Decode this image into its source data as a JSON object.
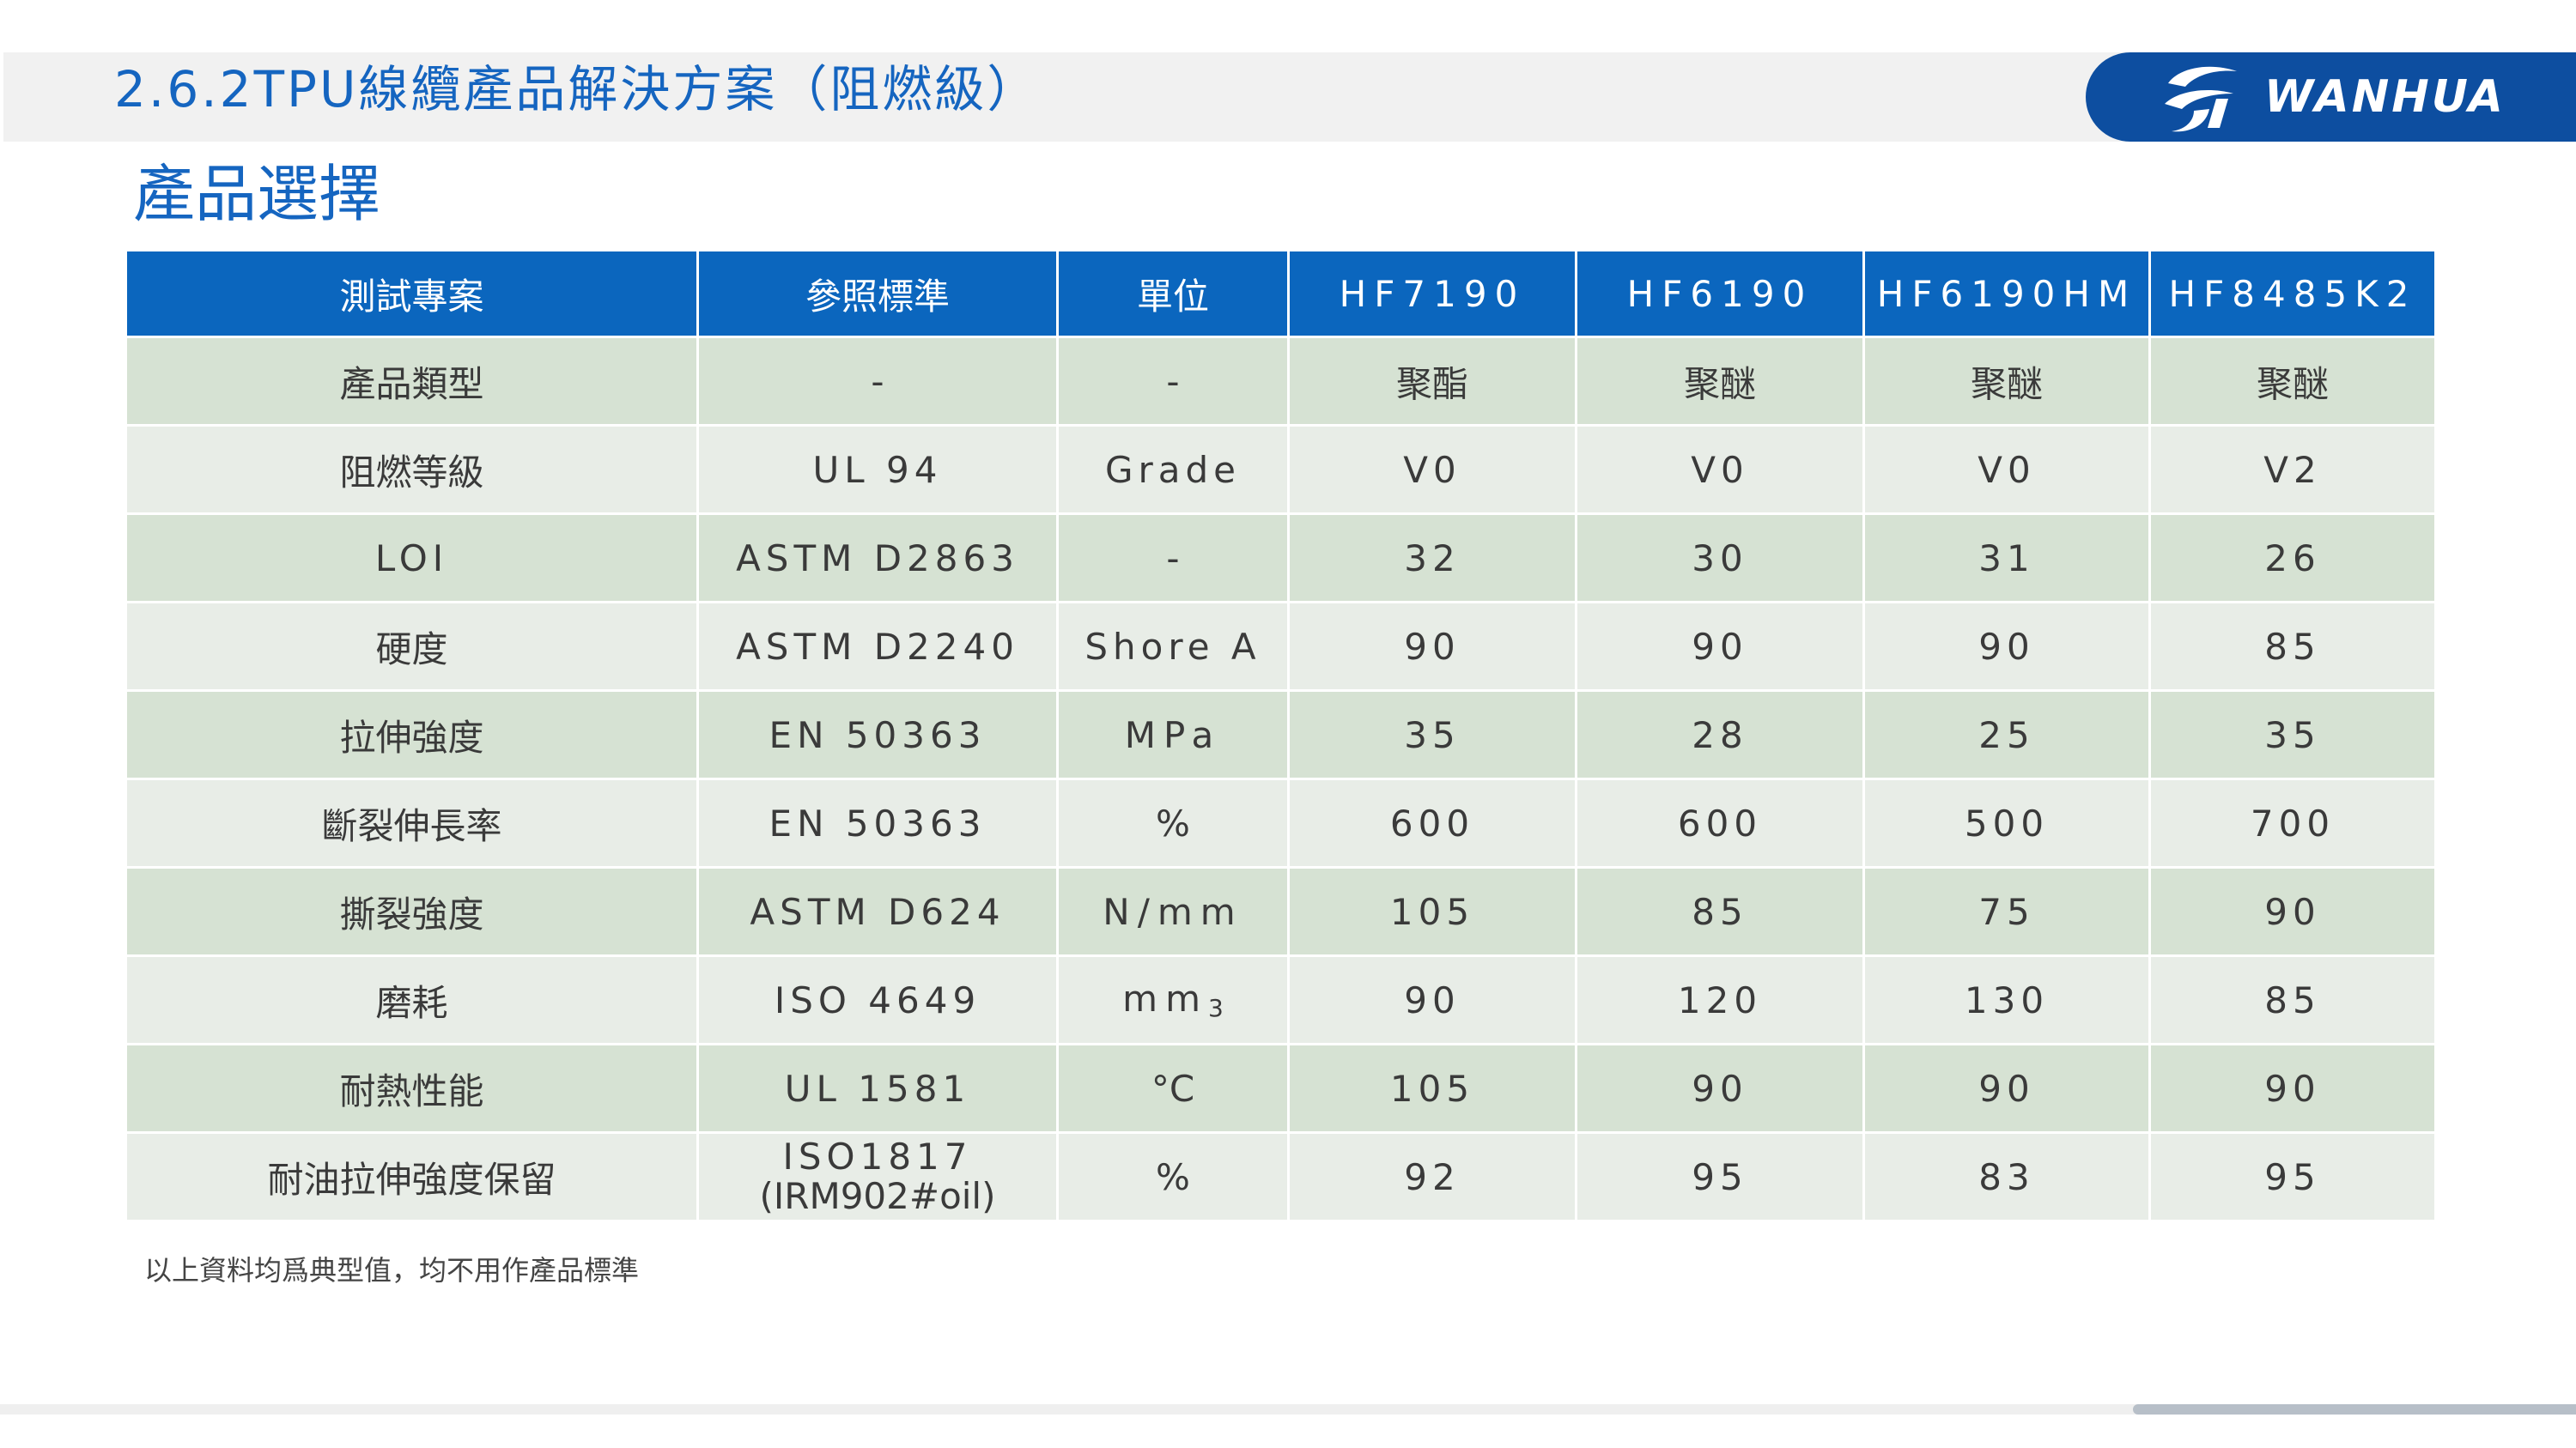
{
  "header": {
    "title": "2.6.2TPU線纜產品解決方案（阻燃級）",
    "brand": "WANHUA"
  },
  "section_title": "產品選擇",
  "table": {
    "headers": [
      "測試專案",
      "參照標準",
      "單位",
      "HF7190",
      "HF6190",
      "HF6190HM",
      "HF8485K2"
    ],
    "rows": [
      {
        "item": "產品類型",
        "standard": "-",
        "unit": "-",
        "values": [
          "聚酯",
          "聚醚",
          "聚醚",
          "聚醚"
        ]
      },
      {
        "item": "阻燃等級",
        "standard": "UL 94",
        "unit": "Grade",
        "values": [
          "V0",
          "V0",
          "V0",
          "V2"
        ]
      },
      {
        "item": "LOI",
        "standard": "ASTM D2863",
        "unit": "-",
        "values": [
          "32",
          "30",
          "31",
          "26"
        ]
      },
      {
        "item": "硬度",
        "standard": "ASTM D2240",
        "unit": "Shore A",
        "values": [
          "90",
          "90",
          "90",
          "85"
        ]
      },
      {
        "item": "拉伸強度",
        "standard": "EN 50363",
        "unit": "MPa",
        "values": [
          "35",
          "28",
          "25",
          "35"
        ]
      },
      {
        "item": "斷裂伸長率",
        "standard": "EN 50363",
        "unit": "%",
        "values": [
          "600",
          "600",
          "500",
          "700"
        ]
      },
      {
        "item": "撕裂強度",
        "standard": "ASTM D624",
        "unit": "N/mm",
        "values": [
          "105",
          "85",
          "75",
          "90"
        ]
      },
      {
        "item": "磨耗",
        "standard": "ISO 4649",
        "unit": "mm",
        "unit_sup": "3",
        "values": [
          "90",
          "120",
          "130",
          "85"
        ]
      },
      {
        "item": "耐熱性能",
        "standard": "UL 1581",
        "unit": "°C",
        "values": [
          "105",
          "90",
          "90",
          "90"
        ]
      },
      {
        "item": "耐油拉伸強度保留",
        "standard": "ISO1817",
        "standard_line2": "(IRM902#oil)",
        "unit": "%",
        "values": [
          "92",
          "95",
          "83",
          "95"
        ]
      }
    ]
  },
  "footnote": "以上資料均爲典型值，均不用作產品標準",
  "colors": {
    "brand_blue": "#0d4ea0",
    "header_blue": "#0b66be",
    "title_blue": "#1565c0",
    "row_dark": "#d6e2d3",
    "row_light": "#e8ede7"
  },
  "icons": {
    "brand_logo": "wanhua-logo-icon"
  }
}
